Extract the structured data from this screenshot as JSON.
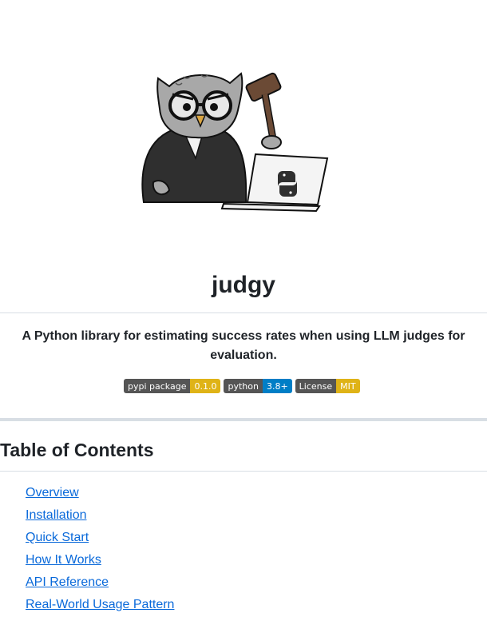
{
  "header": {
    "title": "judgy",
    "subtitle": "A Python library for estimating success rates when using LLM judges for evaluation."
  },
  "badges": [
    {
      "label": "pypi package",
      "value": "0.1.0",
      "color": "#dfb317"
    },
    {
      "label": "python",
      "value": "3.8+",
      "color": "#007ec6"
    },
    {
      "label": "License",
      "value": "MIT",
      "color": "#dfb317"
    }
  ],
  "toc": {
    "heading": "Table of Contents",
    "items": [
      {
        "label": "Overview"
      },
      {
        "label": "Installation"
      },
      {
        "label": "Quick Start"
      },
      {
        "label": "How It Works"
      },
      {
        "label": "API Reference"
      },
      {
        "label": "Real-World Usage Pattern"
      }
    ]
  },
  "colors": {
    "link": "#0969da",
    "text": "#1f2328",
    "rule": "#d8dee4"
  }
}
